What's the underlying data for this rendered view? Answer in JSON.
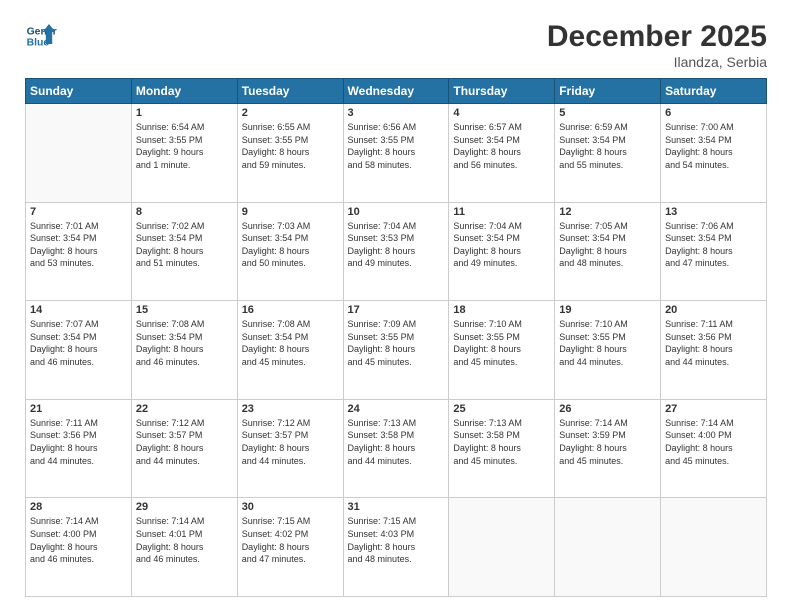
{
  "header": {
    "logo_line1": "General",
    "logo_line2": "Blue",
    "title": "December 2025",
    "subtitle": "Ilandza, Serbia"
  },
  "days_of_week": [
    "Sunday",
    "Monday",
    "Tuesday",
    "Wednesday",
    "Thursday",
    "Friday",
    "Saturday"
  ],
  "weeks": [
    [
      {
        "num": "",
        "info": ""
      },
      {
        "num": "1",
        "info": "Sunrise: 6:54 AM\nSunset: 3:55 PM\nDaylight: 9 hours\nand 1 minute."
      },
      {
        "num": "2",
        "info": "Sunrise: 6:55 AM\nSunset: 3:55 PM\nDaylight: 8 hours\nand 59 minutes."
      },
      {
        "num": "3",
        "info": "Sunrise: 6:56 AM\nSunset: 3:55 PM\nDaylight: 8 hours\nand 58 minutes."
      },
      {
        "num": "4",
        "info": "Sunrise: 6:57 AM\nSunset: 3:54 PM\nDaylight: 8 hours\nand 56 minutes."
      },
      {
        "num": "5",
        "info": "Sunrise: 6:59 AM\nSunset: 3:54 PM\nDaylight: 8 hours\nand 55 minutes."
      },
      {
        "num": "6",
        "info": "Sunrise: 7:00 AM\nSunset: 3:54 PM\nDaylight: 8 hours\nand 54 minutes."
      }
    ],
    [
      {
        "num": "7",
        "info": "Sunrise: 7:01 AM\nSunset: 3:54 PM\nDaylight: 8 hours\nand 53 minutes."
      },
      {
        "num": "8",
        "info": "Sunrise: 7:02 AM\nSunset: 3:54 PM\nDaylight: 8 hours\nand 51 minutes."
      },
      {
        "num": "9",
        "info": "Sunrise: 7:03 AM\nSunset: 3:54 PM\nDaylight: 8 hours\nand 50 minutes."
      },
      {
        "num": "10",
        "info": "Sunrise: 7:04 AM\nSunset: 3:53 PM\nDaylight: 8 hours\nand 49 minutes."
      },
      {
        "num": "11",
        "info": "Sunrise: 7:04 AM\nSunset: 3:54 PM\nDaylight: 8 hours\nand 49 minutes."
      },
      {
        "num": "12",
        "info": "Sunrise: 7:05 AM\nSunset: 3:54 PM\nDaylight: 8 hours\nand 48 minutes."
      },
      {
        "num": "13",
        "info": "Sunrise: 7:06 AM\nSunset: 3:54 PM\nDaylight: 8 hours\nand 47 minutes."
      }
    ],
    [
      {
        "num": "14",
        "info": "Sunrise: 7:07 AM\nSunset: 3:54 PM\nDaylight: 8 hours\nand 46 minutes."
      },
      {
        "num": "15",
        "info": "Sunrise: 7:08 AM\nSunset: 3:54 PM\nDaylight: 8 hours\nand 46 minutes."
      },
      {
        "num": "16",
        "info": "Sunrise: 7:08 AM\nSunset: 3:54 PM\nDaylight: 8 hours\nand 45 minutes."
      },
      {
        "num": "17",
        "info": "Sunrise: 7:09 AM\nSunset: 3:55 PM\nDaylight: 8 hours\nand 45 minutes."
      },
      {
        "num": "18",
        "info": "Sunrise: 7:10 AM\nSunset: 3:55 PM\nDaylight: 8 hours\nand 45 minutes."
      },
      {
        "num": "19",
        "info": "Sunrise: 7:10 AM\nSunset: 3:55 PM\nDaylight: 8 hours\nand 44 minutes."
      },
      {
        "num": "20",
        "info": "Sunrise: 7:11 AM\nSunset: 3:56 PM\nDaylight: 8 hours\nand 44 minutes."
      }
    ],
    [
      {
        "num": "21",
        "info": "Sunrise: 7:11 AM\nSunset: 3:56 PM\nDaylight: 8 hours\nand 44 minutes."
      },
      {
        "num": "22",
        "info": "Sunrise: 7:12 AM\nSunset: 3:57 PM\nDaylight: 8 hours\nand 44 minutes."
      },
      {
        "num": "23",
        "info": "Sunrise: 7:12 AM\nSunset: 3:57 PM\nDaylight: 8 hours\nand 44 minutes."
      },
      {
        "num": "24",
        "info": "Sunrise: 7:13 AM\nSunset: 3:58 PM\nDaylight: 8 hours\nand 44 minutes."
      },
      {
        "num": "25",
        "info": "Sunrise: 7:13 AM\nSunset: 3:58 PM\nDaylight: 8 hours\nand 45 minutes."
      },
      {
        "num": "26",
        "info": "Sunrise: 7:14 AM\nSunset: 3:59 PM\nDaylight: 8 hours\nand 45 minutes."
      },
      {
        "num": "27",
        "info": "Sunrise: 7:14 AM\nSunset: 4:00 PM\nDaylight: 8 hours\nand 45 minutes."
      }
    ],
    [
      {
        "num": "28",
        "info": "Sunrise: 7:14 AM\nSunset: 4:00 PM\nDaylight: 8 hours\nand 46 minutes."
      },
      {
        "num": "29",
        "info": "Sunrise: 7:14 AM\nSunset: 4:01 PM\nDaylight: 8 hours\nand 46 minutes."
      },
      {
        "num": "30",
        "info": "Sunrise: 7:15 AM\nSunset: 4:02 PM\nDaylight: 8 hours\nand 47 minutes."
      },
      {
        "num": "31",
        "info": "Sunrise: 7:15 AM\nSunset: 4:03 PM\nDaylight: 8 hours\nand 48 minutes."
      },
      {
        "num": "",
        "info": ""
      },
      {
        "num": "",
        "info": ""
      },
      {
        "num": "",
        "info": ""
      }
    ]
  ]
}
